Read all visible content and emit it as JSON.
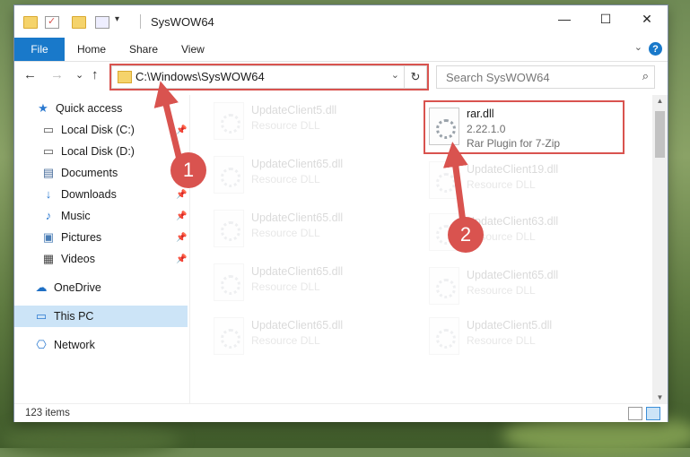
{
  "window": {
    "title": "SysWOW64",
    "controls": {
      "minimize": "—",
      "maximize": "☐",
      "close": "✕"
    }
  },
  "ribbon": {
    "file_tab": "File",
    "tabs": [
      "Home",
      "Share",
      "View"
    ]
  },
  "navbar": {
    "back": "←",
    "forward": "→",
    "recent": "⌄",
    "up": "↑",
    "address": "C:\\Windows\\SysWOW64",
    "refresh": "↻",
    "search_placeholder": "Search SysWOW64",
    "search_icon": "⌕"
  },
  "sidebar": {
    "items": [
      {
        "label": "Quick access",
        "icon": "star-icon",
        "glyph": "★",
        "pinned": false
      },
      {
        "label": "Local Disk (C:)",
        "icon": "drive-icon",
        "glyph": "▭",
        "pinned": true
      },
      {
        "label": "Local Disk (D:)",
        "icon": "drive-icon",
        "glyph": "▭",
        "pinned": false
      },
      {
        "label": "Documents",
        "icon": "document-icon",
        "glyph": "▤",
        "pinned": true
      },
      {
        "label": "Downloads",
        "icon": "download-icon",
        "glyph": "↓",
        "pinned": true
      },
      {
        "label": "Music",
        "icon": "music-icon",
        "glyph": "♪",
        "pinned": true
      },
      {
        "label": "Pictures",
        "icon": "pictures-icon",
        "glyph": "▣",
        "pinned": true
      },
      {
        "label": "Videos",
        "icon": "videos-icon",
        "glyph": "▦",
        "pinned": true
      },
      {
        "label": "OneDrive",
        "icon": "cloud-icon",
        "glyph": "☁",
        "pinned": false
      },
      {
        "label": "This PC",
        "icon": "computer-icon",
        "glyph": "▭",
        "pinned": false
      },
      {
        "label": "Network",
        "icon": "network-icon",
        "glyph": "⎔",
        "pinned": false
      }
    ],
    "pin_glyph": "📌"
  },
  "files": {
    "left_column": [
      {
        "name": "UpdateClient5.dll",
        "desc": "Resource DLL"
      },
      {
        "name": "UpdateClient65.dll",
        "desc": "Resource DLL"
      },
      {
        "name": "UpdateClient65.dll",
        "desc": "Resource DLL"
      },
      {
        "name": "UpdateClient65.dll",
        "desc": "Resource DLL"
      },
      {
        "name": "UpdateClient65.dll",
        "desc": "Resource DLL"
      }
    ],
    "right_column": [
      {
        "name": "UpdateClient19.dll",
        "desc": "Resource DLL"
      },
      {
        "name": "UpdateClient63.dll",
        "desc": "Resource DLL"
      },
      {
        "name": "UpdateClient65.dll",
        "desc": "Resource DLL"
      },
      {
        "name": "UpdateClient5.dll",
        "desc": "Resource DLL"
      }
    ],
    "highlighted": {
      "name": "rar.dll",
      "version": "2.22.1.0",
      "desc": "Rar Plugin for 7-Zip"
    }
  },
  "statusbar": {
    "item_count": "123 items"
  },
  "annotations": {
    "badge_1": "1",
    "badge_2": "2",
    "color": "#d9534f"
  }
}
